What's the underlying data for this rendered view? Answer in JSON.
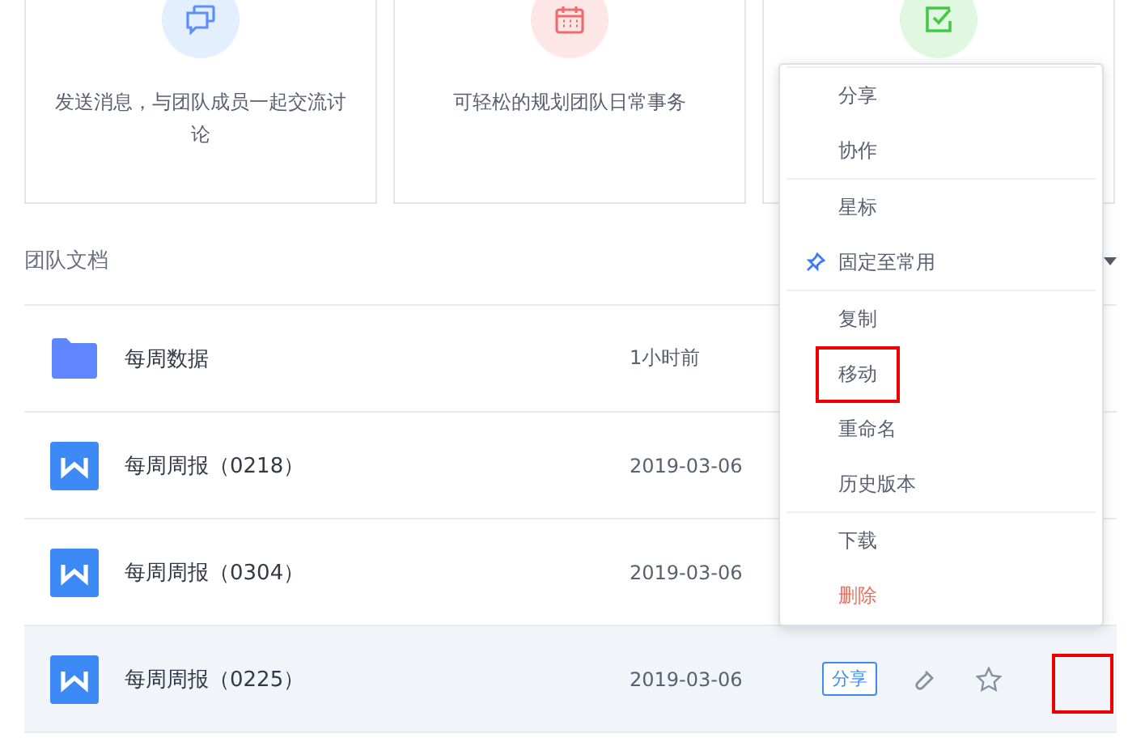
{
  "cards": [
    {
      "kind": "chat",
      "text": "发送消息，与团队成员一起交流讨论"
    },
    {
      "kind": "calendar",
      "text": "可轻松的规划团队日常事务"
    },
    {
      "kind": "task"
    }
  ],
  "section": {
    "title": "团队文档"
  },
  "rows": [
    {
      "kind": "folder",
      "name": "每周数据",
      "time": "1小时前",
      "selected": false
    },
    {
      "kind": "doc",
      "name": "每周周报（0218）",
      "time": "2019-03-06",
      "selected": false
    },
    {
      "kind": "doc",
      "name": "每周周报（0304）",
      "time": "2019-03-06",
      "selected": false
    },
    {
      "kind": "doc",
      "name": "每周周报（0225）",
      "time": "2019-03-06",
      "selected": true,
      "share_button": "分享",
      "more_highlighted": true
    }
  ],
  "menu": {
    "groups": [
      [
        {
          "kind": "plain",
          "label": "分享",
          "highlighted": false
        },
        {
          "kind": "plain",
          "label": "协作",
          "highlighted": false
        }
      ],
      [
        {
          "kind": "plain",
          "label": "星标",
          "highlighted": false
        },
        {
          "kind": "pin",
          "label": "固定至常用",
          "highlighted": false
        }
      ],
      [
        {
          "kind": "plain",
          "label": "复制",
          "highlighted": false
        },
        {
          "kind": "plain",
          "label": "移动",
          "highlighted": true
        },
        {
          "kind": "plain",
          "label": "重命名",
          "highlighted": false
        },
        {
          "kind": "plain",
          "label": "历史版本",
          "highlighted": false
        }
      ],
      [
        {
          "kind": "plain",
          "label": "下载",
          "highlighted": false
        },
        {
          "kind": "danger",
          "label": "删除",
          "highlighted": false
        }
      ]
    ]
  }
}
